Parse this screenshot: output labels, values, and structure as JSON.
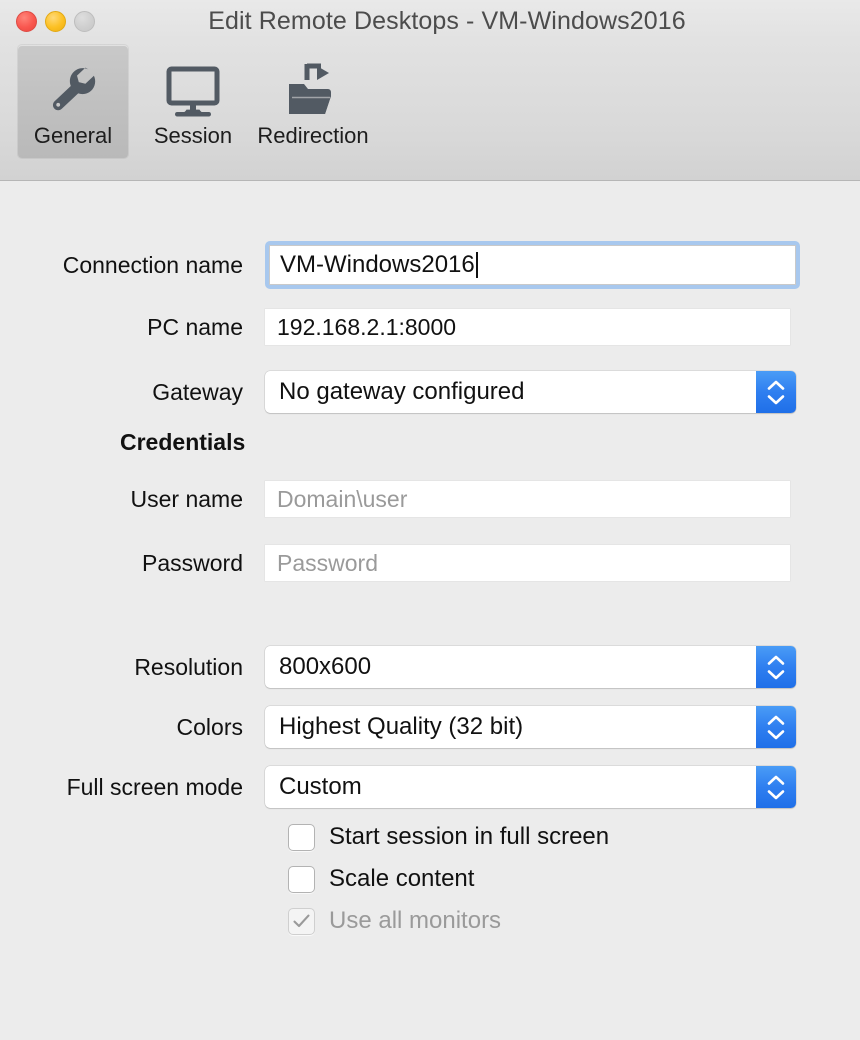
{
  "window": {
    "title": "Edit Remote Desktops - VM-Windows2016",
    "traffic_lights": [
      {
        "name": "close",
        "color": "#f9574f",
        "enabled": true
      },
      {
        "name": "minimize",
        "color": "#fcc023",
        "enabled": true
      },
      {
        "name": "zoom",
        "color": "#cfcfcf",
        "enabled": false
      }
    ]
  },
  "toolbar": {
    "tabs": [
      {
        "label": "General",
        "icon": "wrench-icon",
        "selected": true
      },
      {
        "label": "Session",
        "icon": "monitor-icon",
        "selected": false
      },
      {
        "label": "Redirection",
        "icon": "folder-arrow-icon",
        "selected": false
      }
    ]
  },
  "form": {
    "connection_name": {
      "label": "Connection name",
      "value": "VM-Windows2016",
      "focused": true
    },
    "pc_name": {
      "label": "PC name",
      "value": "192.168.2.1:8000",
      "focused": false
    },
    "gateway": {
      "label": "Gateway",
      "value": "No gateway configured"
    },
    "credentials_header": "Credentials",
    "user_name": {
      "label": "User name",
      "value": "",
      "placeholder": "Domain\\user"
    },
    "password": {
      "label": "Password",
      "value": "",
      "placeholder": "Password"
    },
    "resolution": {
      "label": "Resolution",
      "value": "800x600"
    },
    "colors": {
      "label": "Colors",
      "value": "Highest Quality (32 bit)"
    },
    "full_screen_mode": {
      "label": "Full screen mode",
      "value": "Custom"
    },
    "checkboxes": [
      {
        "label": "Start session in full screen",
        "checked": false,
        "disabled": false
      },
      {
        "label": "Scale content",
        "checked": false,
        "disabled": false
      },
      {
        "label": "Use all monitors",
        "checked": true,
        "disabled": true
      }
    ]
  },
  "colors": {
    "window_background": "#ececec",
    "toolbar_top": "#e9e9e9",
    "toolbar_bottom": "#d2d2d2",
    "selected_tab": "#c2c2c2",
    "icon_gray": "#525a63",
    "focus_ring": "#a8c8ee",
    "stepper_blue": "#2f7ff0",
    "placeholder_gray": "#9a9a9a",
    "disabled_gray": "#9a9a9a",
    "text": "#111111",
    "title_text": "#4c4c4c"
  }
}
